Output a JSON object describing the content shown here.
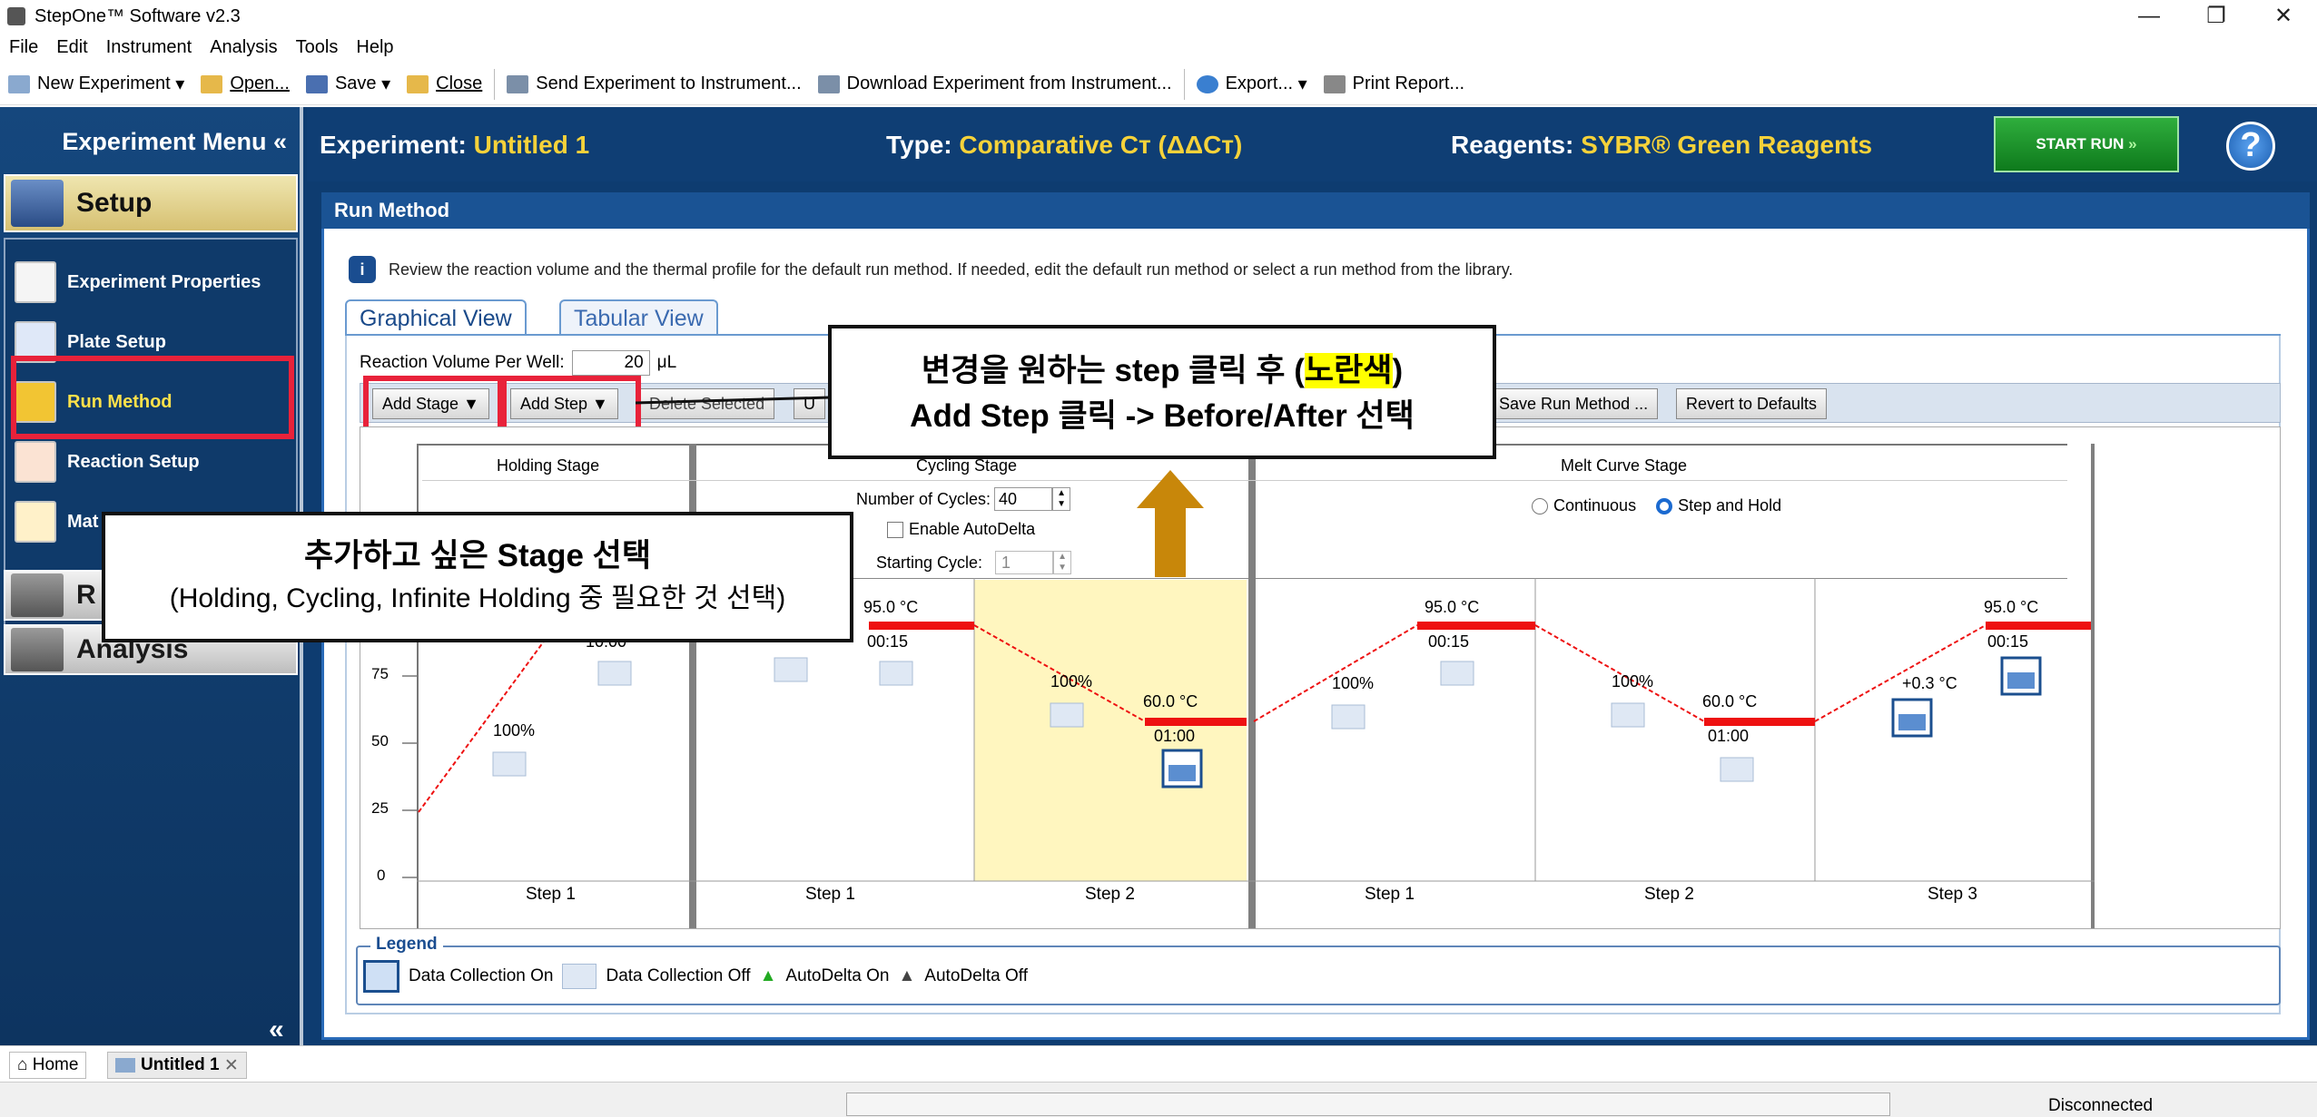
{
  "window": {
    "title": "StepOne™ Software v2.3",
    "minimize": "—",
    "restore": "❐",
    "close": "✕"
  },
  "menu": [
    "File",
    "Edit",
    "Instrument",
    "Analysis",
    "Tools",
    "Help"
  ],
  "toolbar": {
    "new_experiment": "New Experiment",
    "open": "Open...",
    "save": "Save",
    "close": "Close",
    "send": "Send Experiment to Instrument...",
    "download": "Download Experiment from Instrument...",
    "export": "Export...",
    "print": "Print Report..."
  },
  "sidebar": {
    "header": "Experiment Menu",
    "collapse_glyph": "«",
    "setup": "Setup",
    "items": [
      {
        "label": "Experiment Properties",
        "icon": "document-icon"
      },
      {
        "label": "Plate Setup",
        "icon": "plate-icon"
      },
      {
        "label": "Run Method",
        "icon": "run-method-icon"
      },
      {
        "label": "Reaction Setup",
        "icon": "pipette-icon"
      },
      {
        "label": "Mat",
        "icon": "cart-icon"
      }
    ],
    "run_section": "R",
    "analysis": "Analysis"
  },
  "experiment": {
    "experiment_label": "Experiment:",
    "experiment_value": "Untitled 1",
    "type_label": "Type:",
    "type_value": "Comparative Cт (ΔΔCт)",
    "reagents_label": "Reagents:",
    "reagents_value": "SYBR® Green Reagents",
    "start_run": "START RUN",
    "help": "?"
  },
  "panel": {
    "title": "Run Method",
    "info": "Review the reaction volume and the thermal profile for the default run method. If needed, edit the default run method or select a run method from the library.",
    "tabs": [
      "Graphical View",
      "Tabular View"
    ],
    "reaction_volume_label": "Reaction Volume Per Well:",
    "reaction_volume_value": "20",
    "reaction_volume_unit": "μL",
    "buttons": {
      "add_stage": "Add Stage ▼",
      "add_step": "Add Step ▼",
      "delete_selected": "Delete Selected",
      "undo": "U",
      "save_run_method": "Save Run Method ...",
      "revert": "Revert to Defaults"
    }
  },
  "graph": {
    "stages": [
      {
        "name": "Holding Stage"
      },
      {
        "name": "Cycling Stage",
        "cycles_label": "Number of Cycles:",
        "cycles_value": "40",
        "autodelta": "Enable AutoDelta",
        "starting_cycle_label": "Starting Cycle:",
        "starting_cycle_value": "1"
      },
      {
        "name": "Melt Curve Stage",
        "continuous": "Continuous",
        "step_and_hold": "Step and Hold"
      }
    ],
    "y_ticks": [
      "0",
      "25",
      "50",
      "75"
    ],
    "step_labels": [
      "Step 1",
      "Step 1",
      "Step 2",
      "Step 1",
      "Step 2",
      "Step 3"
    ],
    "labels": {
      "hold_ramp": "100%",
      "hold_time": "10:00",
      "c1_temp": "95.0 °C",
      "c1_time": "00:15",
      "c2_ramp": "100%",
      "c2_temp": "60.0 °C",
      "c2_time": "01:00",
      "m1_ramp": "100%",
      "m1_temp": "95.0 °C",
      "m1_time": "00:15",
      "m2_ramp": "100%",
      "m2_temp": "60.0 °C",
      "m2_time": "01:00",
      "m3_ramp": "+0.3 °C",
      "m3_temp": "95.0 °C",
      "m3_time": "00:15"
    },
    "colors": {
      "hold_line": "#ee1111",
      "selected_step": "#fff6bf",
      "ramp_line": "#ee1111"
    }
  },
  "legend": {
    "title": "Legend",
    "on": "Data Collection On",
    "off": "Data Collection Off",
    "ad_on": "AutoDelta On",
    "ad_off": "AutoDelta Off"
  },
  "callouts": {
    "top_line1_a": "변경을 원하는 step 클릭 후 (",
    "top_line1_hl": "노란색",
    "top_line1_b": ")",
    "top_line2": "Add Step 클릭  -> Before/After 선택",
    "left_line1": "추가하고 싶은 Stage 선택",
    "left_line2": "(Holding, Cycling, Infinite Holding 중 필요한 것 선택)"
  },
  "bottom_tabs": {
    "home": "Home",
    "doc": "Untitled 1",
    "doc_close": "✕"
  },
  "status": {
    "connection": "Disconnected"
  }
}
